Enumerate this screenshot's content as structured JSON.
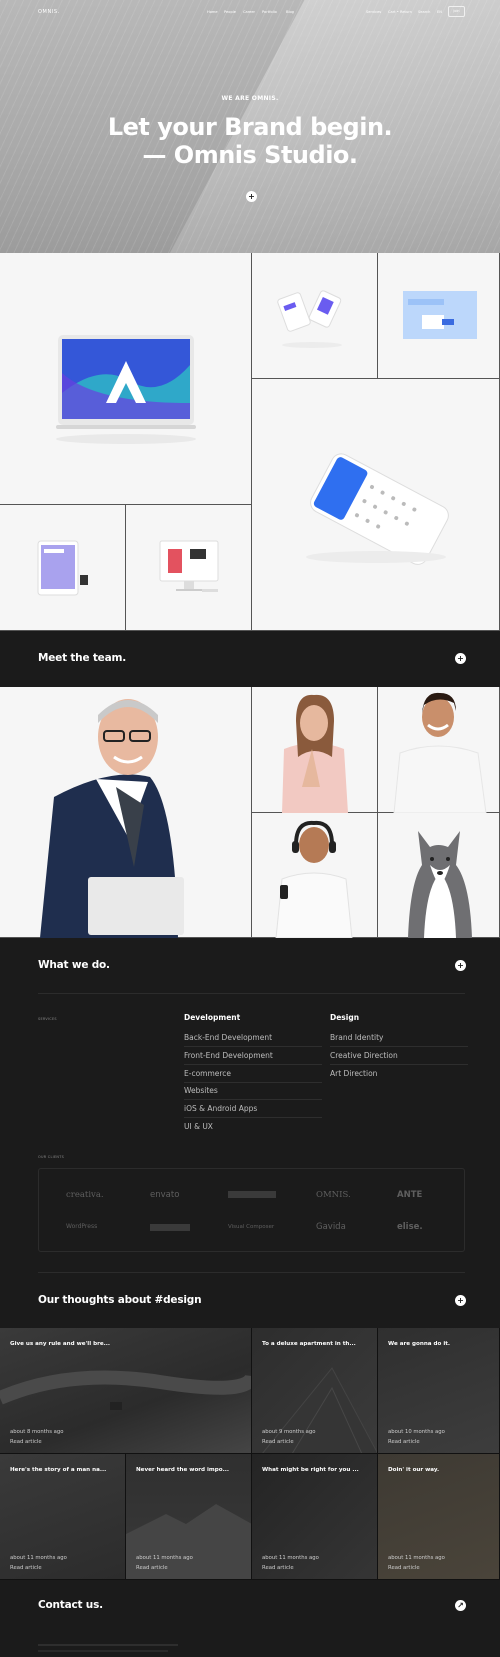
{
  "nav": {
    "logo": "OMNIS.",
    "items": [
      "Home",
      "People",
      "Career",
      "Portfolio",
      "Blog"
    ],
    "right_items": [
      "Services",
      "Cart • Return",
      "Search"
    ],
    "language": "EN",
    "button": "Join"
  },
  "hero": {
    "eyebrow": "WE ARE OMNIS.",
    "headline_line1": "Let your Brand begin.",
    "headline_line2": "— Omnis Studio.",
    "cta_icon": "plus-icon"
  },
  "team": {
    "title": "Meet the team."
  },
  "services": {
    "title": "What we do.",
    "label": "SERVICES",
    "development": {
      "heading": "Development",
      "items": [
        "Back-End Development",
        "Front-End Development",
        "E-commerce",
        "Websites",
        "iOS & Android Apps",
        "UI & UX"
      ]
    },
    "design": {
      "heading": "Design",
      "items": [
        "Brand Identity",
        "Creative Direction",
        "Art Direction"
      ]
    },
    "clients_label": "OUR CLIENTS",
    "clients_row1": [
      "creativa.",
      "envato",
      "",
      "OMNIS.",
      "ANTE"
    ],
    "clients_row2": [
      "WordPress",
      "",
      "Visual Composer",
      "Gavida",
      "elise."
    ]
  },
  "blog": {
    "title": "Our thoughts about #design",
    "posts": [
      {
        "title": "Give us any rule and we'll bre...",
        "meta": "about 8 months ago",
        "link": "Read article"
      },
      {
        "title": "To a deluxe apartment in th...",
        "meta": "about 9 months ago",
        "link": "Read article"
      },
      {
        "title": "We are gonna do it.",
        "meta": "about 10 months ago",
        "link": "Read article"
      },
      {
        "title": "Here's the story of a man na...",
        "meta": "about 11 months ago",
        "link": "Read article"
      },
      {
        "title": "Never heard the word impo...",
        "meta": "about 11 months ago",
        "link": "Read article"
      },
      {
        "title": "What might be right for you ...",
        "meta": "about 11 months ago",
        "link": "Read article"
      },
      {
        "title": "Doin' it our way.",
        "meta": "about 11 months ago",
        "link": "Read article"
      }
    ]
  },
  "contact": {
    "title": "Contact us."
  }
}
